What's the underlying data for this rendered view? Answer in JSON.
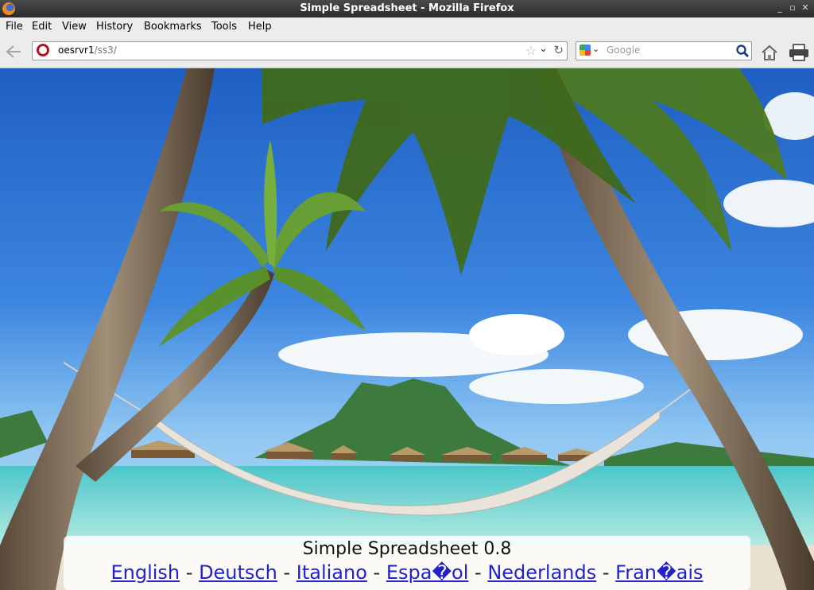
{
  "window": {
    "title": "Simple Spreadsheet - Mozilla Firefox"
  },
  "menu": [
    "File",
    "Edit",
    "View",
    "History",
    "Bookmarks",
    "Tools",
    "Help"
  ],
  "urlbar": {
    "host": "oesrvr1",
    "path": "/ss3/"
  },
  "search": {
    "placeholder": "Google"
  },
  "page": {
    "app_title": "Simple Spreadsheet 0.8",
    "separator": " - ",
    "languages": [
      "English",
      "Deutsch",
      "Italiano",
      "Espa�ol",
      "Nederlands",
      "Fran�ais"
    ]
  }
}
